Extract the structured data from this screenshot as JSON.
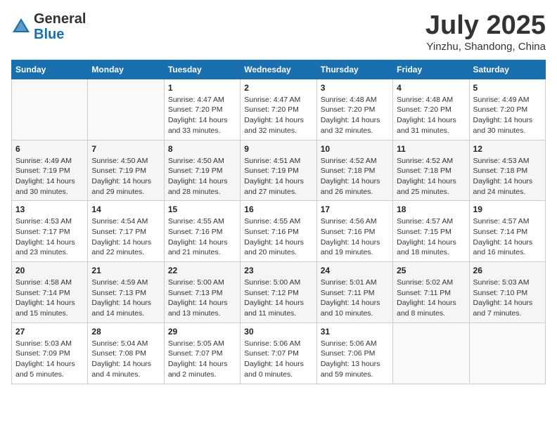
{
  "header": {
    "logo_general": "General",
    "logo_blue": "Blue",
    "month_title": "July 2025",
    "location": "Yinzhu, Shandong, China"
  },
  "weekdays": [
    "Sunday",
    "Monday",
    "Tuesday",
    "Wednesday",
    "Thursday",
    "Friday",
    "Saturday"
  ],
  "weeks": [
    [
      {
        "day": "",
        "info": ""
      },
      {
        "day": "",
        "info": ""
      },
      {
        "day": "1",
        "info": "Sunrise: 4:47 AM\nSunset: 7:20 PM\nDaylight: 14 hours and 33 minutes."
      },
      {
        "day": "2",
        "info": "Sunrise: 4:47 AM\nSunset: 7:20 PM\nDaylight: 14 hours and 32 minutes."
      },
      {
        "day": "3",
        "info": "Sunrise: 4:48 AM\nSunset: 7:20 PM\nDaylight: 14 hours and 32 minutes."
      },
      {
        "day": "4",
        "info": "Sunrise: 4:48 AM\nSunset: 7:20 PM\nDaylight: 14 hours and 31 minutes."
      },
      {
        "day": "5",
        "info": "Sunrise: 4:49 AM\nSunset: 7:20 PM\nDaylight: 14 hours and 30 minutes."
      }
    ],
    [
      {
        "day": "6",
        "info": "Sunrise: 4:49 AM\nSunset: 7:19 PM\nDaylight: 14 hours and 30 minutes."
      },
      {
        "day": "7",
        "info": "Sunrise: 4:50 AM\nSunset: 7:19 PM\nDaylight: 14 hours and 29 minutes."
      },
      {
        "day": "8",
        "info": "Sunrise: 4:50 AM\nSunset: 7:19 PM\nDaylight: 14 hours and 28 minutes."
      },
      {
        "day": "9",
        "info": "Sunrise: 4:51 AM\nSunset: 7:19 PM\nDaylight: 14 hours and 27 minutes."
      },
      {
        "day": "10",
        "info": "Sunrise: 4:52 AM\nSunset: 7:18 PM\nDaylight: 14 hours and 26 minutes."
      },
      {
        "day": "11",
        "info": "Sunrise: 4:52 AM\nSunset: 7:18 PM\nDaylight: 14 hours and 25 minutes."
      },
      {
        "day": "12",
        "info": "Sunrise: 4:53 AM\nSunset: 7:18 PM\nDaylight: 14 hours and 24 minutes."
      }
    ],
    [
      {
        "day": "13",
        "info": "Sunrise: 4:53 AM\nSunset: 7:17 PM\nDaylight: 14 hours and 23 minutes."
      },
      {
        "day": "14",
        "info": "Sunrise: 4:54 AM\nSunset: 7:17 PM\nDaylight: 14 hours and 22 minutes."
      },
      {
        "day": "15",
        "info": "Sunrise: 4:55 AM\nSunset: 7:16 PM\nDaylight: 14 hours and 21 minutes."
      },
      {
        "day": "16",
        "info": "Sunrise: 4:55 AM\nSunset: 7:16 PM\nDaylight: 14 hours and 20 minutes."
      },
      {
        "day": "17",
        "info": "Sunrise: 4:56 AM\nSunset: 7:16 PM\nDaylight: 14 hours and 19 minutes."
      },
      {
        "day": "18",
        "info": "Sunrise: 4:57 AM\nSunset: 7:15 PM\nDaylight: 14 hours and 18 minutes."
      },
      {
        "day": "19",
        "info": "Sunrise: 4:57 AM\nSunset: 7:14 PM\nDaylight: 14 hours and 16 minutes."
      }
    ],
    [
      {
        "day": "20",
        "info": "Sunrise: 4:58 AM\nSunset: 7:14 PM\nDaylight: 14 hours and 15 minutes."
      },
      {
        "day": "21",
        "info": "Sunrise: 4:59 AM\nSunset: 7:13 PM\nDaylight: 14 hours and 14 minutes."
      },
      {
        "day": "22",
        "info": "Sunrise: 5:00 AM\nSunset: 7:13 PM\nDaylight: 14 hours and 13 minutes."
      },
      {
        "day": "23",
        "info": "Sunrise: 5:00 AM\nSunset: 7:12 PM\nDaylight: 14 hours and 11 minutes."
      },
      {
        "day": "24",
        "info": "Sunrise: 5:01 AM\nSunset: 7:11 PM\nDaylight: 14 hours and 10 minutes."
      },
      {
        "day": "25",
        "info": "Sunrise: 5:02 AM\nSunset: 7:11 PM\nDaylight: 14 hours and 8 minutes."
      },
      {
        "day": "26",
        "info": "Sunrise: 5:03 AM\nSunset: 7:10 PM\nDaylight: 14 hours and 7 minutes."
      }
    ],
    [
      {
        "day": "27",
        "info": "Sunrise: 5:03 AM\nSunset: 7:09 PM\nDaylight: 14 hours and 5 minutes."
      },
      {
        "day": "28",
        "info": "Sunrise: 5:04 AM\nSunset: 7:08 PM\nDaylight: 14 hours and 4 minutes."
      },
      {
        "day": "29",
        "info": "Sunrise: 5:05 AM\nSunset: 7:07 PM\nDaylight: 14 hours and 2 minutes."
      },
      {
        "day": "30",
        "info": "Sunrise: 5:06 AM\nSunset: 7:07 PM\nDaylight: 14 hours and 0 minutes."
      },
      {
        "day": "31",
        "info": "Sunrise: 5:06 AM\nSunset: 7:06 PM\nDaylight: 13 hours and 59 minutes."
      },
      {
        "day": "",
        "info": ""
      },
      {
        "day": "",
        "info": ""
      }
    ]
  ]
}
